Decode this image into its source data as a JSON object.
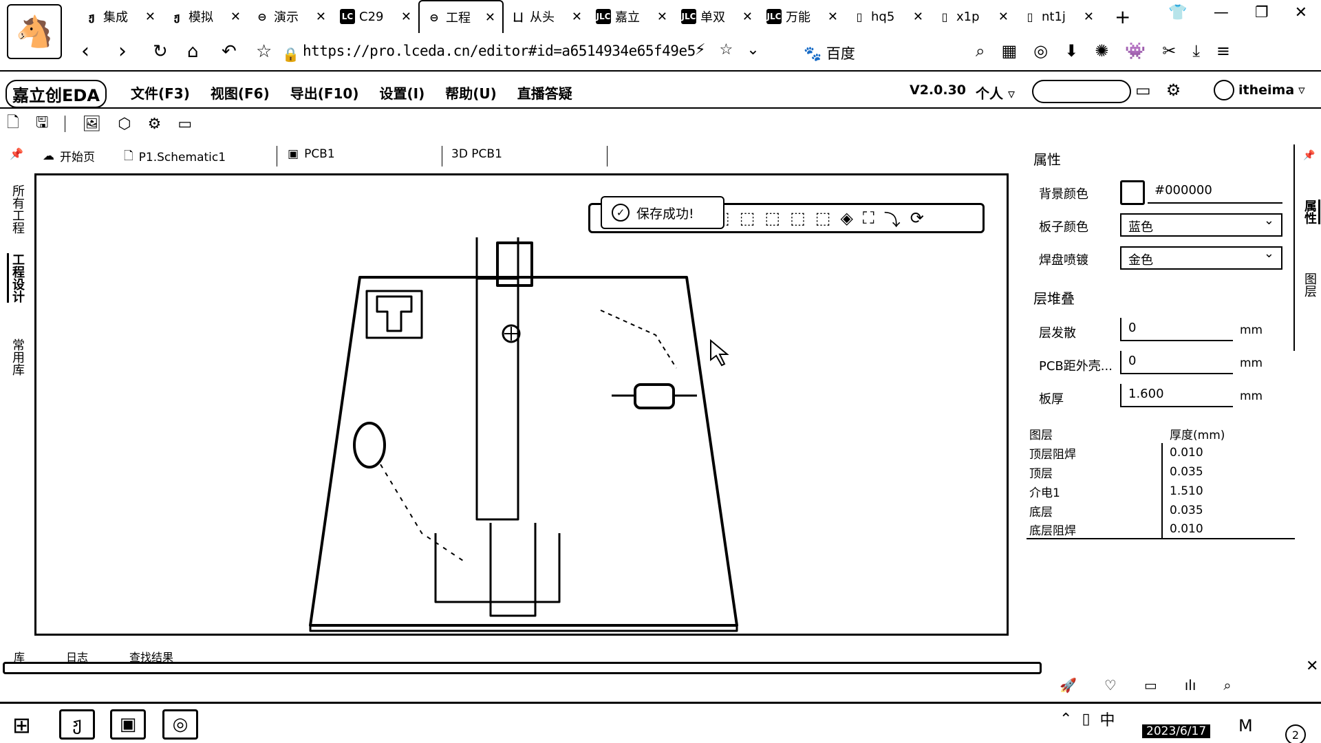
{
  "browser": {
    "tabs": [
      {
        "icon": "spiral",
        "icon_glyph": "ჟ",
        "title": "集成"
      },
      {
        "icon": "spiral",
        "icon_glyph": "ჟ",
        "title": "模拟"
      },
      {
        "icon": "cloud",
        "icon_glyph": "⊖",
        "title": "演示"
      },
      {
        "icon": "lc-logo",
        "icon_glyph": "LC",
        "title": "C29"
      },
      {
        "icon": "cloud",
        "icon_glyph": "⊖",
        "title": "工程"
      },
      {
        "icon": "doc",
        "icon_glyph": "ㄩ",
        "title": "从头"
      },
      {
        "icon": "jlc-logo",
        "icon_glyph": "JLC",
        "title": "嘉立"
      },
      {
        "icon": "jlc-logo",
        "icon_glyph": "JLC",
        "title": "单双"
      },
      {
        "icon": "jlc-logo",
        "icon_glyph": "JLC",
        "title": "万能"
      },
      {
        "icon": "file",
        "icon_glyph": "▯",
        "title": "hq5"
      },
      {
        "icon": "file",
        "icon_glyph": "▯",
        "title": "x1p"
      },
      {
        "icon": "file",
        "icon_glyph": "▯",
        "title": "nt1j"
      }
    ],
    "url": "https://pro.lceda.cn/editor#id=a6514934e65f49e5",
    "search_engine_label": "百度"
  },
  "app": {
    "logo_text": "嘉立创EDA",
    "menu": [
      "文件(F3)",
      "视图(F6)",
      "导出(F10)",
      "设置(I)",
      "帮助(U)",
      "直播答疑"
    ],
    "version": "V2.0.30",
    "team_label": "个人",
    "username": "itheima"
  },
  "doc_tabs": [
    {
      "icon": "home-icon",
      "label": "开始页"
    },
    {
      "icon": "schematic-icon",
      "label": "P1.Schematic1"
    },
    {
      "icon": "pcb-icon",
      "label": "PCB1"
    },
    {
      "icon": "3d-icon",
      "label": "3D PCB1"
    }
  ],
  "left_tabs": [
    "所有工程",
    "工程设计",
    "常用库"
  ],
  "viewport": {
    "toast": "保存成功!"
  },
  "properties": {
    "title": "属性",
    "bg_color_label": "背景颜色",
    "bg_color_value": "#000000",
    "board_color_label": "板子颜色",
    "board_color_value": "蓝色",
    "pad_finish_label": "焊盘喷镀",
    "pad_finish_value": "金色",
    "stackup_title": "层堆叠",
    "layer_spread_label": "层发散",
    "layer_spread_value": "0",
    "pcb_distance_label": "PCB距外壳...",
    "pcb_distance_value": "0",
    "thickness_label": "板厚",
    "thickness_value": "1.600",
    "unit": "mm",
    "table_headers": [
      "图层",
      "厚度(mm)"
    ],
    "layers": [
      {
        "name": "顶层阻焊",
        "thickness": "0.010"
      },
      {
        "name": "顶层",
        "thickness": "0.035"
      },
      {
        "name": "介电1",
        "thickness": "1.510"
      },
      {
        "name": "底层",
        "thickness": "0.035"
      },
      {
        "name": "底层阻焊",
        "thickness": "0.010"
      }
    ]
  },
  "right_tabs": [
    "属性",
    "图层"
  ],
  "bottom_tabs": [
    "库",
    "日志",
    "查找结果"
  ],
  "taskbar": {
    "date": "2023/6/17",
    "ime": "中",
    "notifications": "2"
  }
}
